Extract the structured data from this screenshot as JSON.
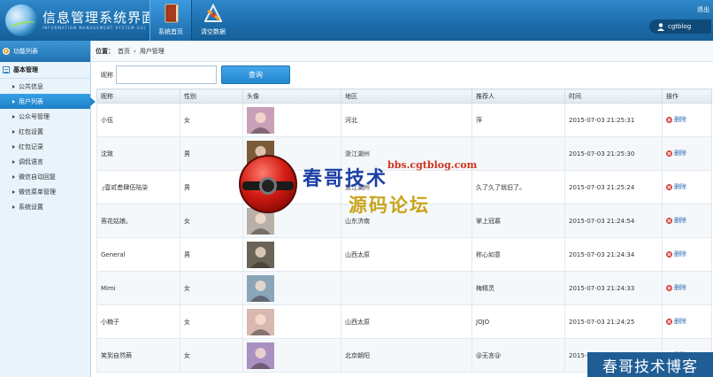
{
  "header": {
    "title": "信息管理系统界面",
    "subtitle": "INFORMATION MANAGEMENT SYSTEM GUI",
    "nav": [
      {
        "label": "系统首页",
        "icon": "book-icon",
        "active": true
      },
      {
        "label": "清空数据",
        "icon": "tools-icon",
        "active": false
      }
    ],
    "exit_label": "退出",
    "username": "cgtblog",
    "colors": {
      "header": "#1d6fae",
      "accent": "#2386cf"
    }
  },
  "sidebar": {
    "title": "功能列表",
    "group": "基本管理",
    "items": [
      {
        "label": "公共信息"
      },
      {
        "label": "用户列表",
        "active": true
      },
      {
        "label": "公众号管理"
      },
      {
        "label": "红包设置"
      },
      {
        "label": "红包记录"
      },
      {
        "label": "调侃语言"
      },
      {
        "label": "微信自动回复"
      },
      {
        "label": "微信菜单管理"
      },
      {
        "label": "系统设置"
      }
    ]
  },
  "breadcrumb": {
    "prefix": "位置：",
    "items": [
      "首页",
      "用户管理"
    ],
    "separator": "›"
  },
  "search": {
    "label": "昵称",
    "value": "",
    "placeholder": "",
    "button": "查询"
  },
  "table": {
    "columns": [
      "昵称",
      "性别",
      "头像",
      "地区",
      "推荐人",
      "时间",
      "操作"
    ],
    "rows": [
      {
        "nickname": "小伍",
        "gender": "女",
        "region": "河北",
        "referrer": "萍",
        "time": "2015-07-03 21:25:31",
        "action": "删除",
        "avatar_color": "#c9a0b8"
      },
      {
        "nickname": "沈致",
        "gender": "男",
        "region": "浙江湖州",
        "referrer": "",
        "time": "2015-07-03 21:25:30",
        "action": "删除",
        "avatar_color": "#7a5a3a"
      },
      {
        "nickname": "╭壹贰叁肆伍陆柒",
        "gender": "男",
        "region": "浙江湖州",
        "referrer": "久了久了就旧了。",
        "time": "2015-07-03 21:25:24",
        "action": "删除",
        "avatar_color": "#444444"
      },
      {
        "nickname": "蓉花姑娘。",
        "gender": "女",
        "region": "山东济南",
        "referrer": "掌上冠慕",
        "time": "2015-07-03 21:24:54",
        "action": "删除",
        "avatar_color": "#b8b0a8"
      },
      {
        "nickname": "General",
        "gender": "男",
        "region": "山西太原",
        "referrer": "称心如意",
        "time": "2015-07-03 21:24:34",
        "action": "删除",
        "avatar_color": "#6a6458"
      },
      {
        "nickname": "Mimi",
        "gender": "女",
        "region": "",
        "referrer": "梅精灵",
        "time": "2015-07-03 21:24:33",
        "action": "删除",
        "avatar_color": "#8aa4b8"
      },
      {
        "nickname": "小楠子",
        "gender": "女",
        "region": "山西太原",
        "referrer": "JOJO",
        "time": "2015-07-03 21:24:25",
        "action": "删除",
        "avatar_color": "#d8b8b0"
      },
      {
        "nickname": "笑到自然萌",
        "gender": "女",
        "region": "北京朝阳",
        "referrer": "@无言@",
        "time": "2015-07-03 21:24:15",
        "action": "删除",
        "avatar_color": "#a890c0"
      }
    ]
  },
  "watermark": {
    "line1": "春哥技术",
    "url": "bbs.cgtblog.com",
    "line2": "源码论坛",
    "corner": "春哥技术博客"
  }
}
